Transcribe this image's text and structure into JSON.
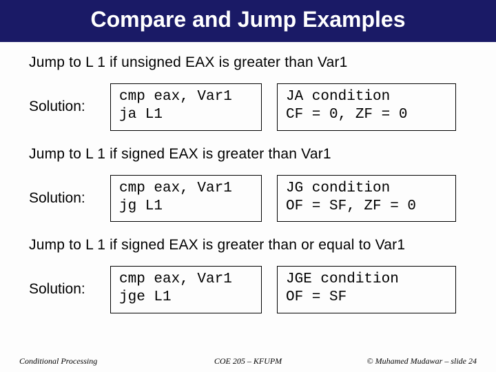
{
  "title": "Compare and Jump Examples",
  "blocks": [
    {
      "prompt": "Jump to L 1 if unsigned EAX is greater than Var1",
      "label": "Solution:",
      "code": "cmp eax, Var1\nja L1",
      "cond": "JA condition\nCF = 0, ZF = 0"
    },
    {
      "prompt": "Jump to L 1 if signed EAX is greater than Var1",
      "label": "Solution:",
      "code": "cmp eax, Var1\njg L1",
      "cond": "JG condition\nOF = SF, ZF = 0"
    },
    {
      "prompt": "Jump to L 1 if signed EAX is greater than or equal to Var1",
      "label": "Solution:",
      "code": "cmp eax, Var1\njge L1",
      "cond": "JGE condition\nOF = SF"
    }
  ],
  "footer": {
    "left": "Conditional Processing",
    "center": "COE 205 – KFUPM",
    "right": "© Muhamed Mudawar – slide 24"
  }
}
